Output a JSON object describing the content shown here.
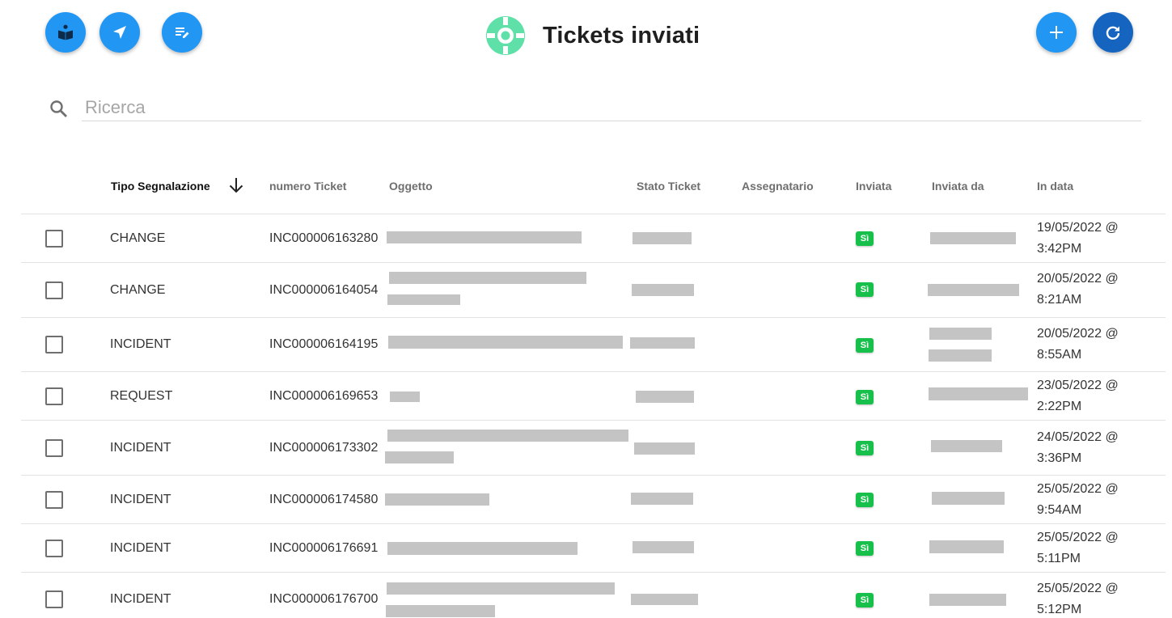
{
  "colors": {
    "fab_blue": "#2196f3",
    "fab_dark_blue": "#1565c0",
    "logo_green": "#5ee0a8",
    "badge_green": "#16c04b",
    "redaction_gray": "#c4c4c4"
  },
  "toolbar": {
    "left_buttons": [
      {
        "icon": "reading-book-icon"
      },
      {
        "icon": "send-navigation-icon"
      },
      {
        "icon": "edit-note-icon"
      }
    ],
    "right_buttons": [
      {
        "icon": "add-icon"
      },
      {
        "icon": "refresh-icon"
      }
    ]
  },
  "header": {
    "logo_icon": "lifebuoy-icon",
    "title": "Tickets inviati"
  },
  "search": {
    "icon": "search-icon",
    "placeholder": "Ricerca",
    "value": ""
  },
  "table": {
    "columns": [
      {
        "key": "tipo",
        "label": "Tipo Segnalazione",
        "sorted": true,
        "sort_direction": "descending"
      },
      {
        "key": "numero",
        "label": "numero Ticket"
      },
      {
        "key": "oggetto",
        "label": "Oggetto"
      },
      {
        "key": "stato",
        "label": "Stato Ticket"
      },
      {
        "key": "assegnatario",
        "label": "Assegnatario"
      },
      {
        "key": "inviata",
        "label": "Inviata"
      },
      {
        "key": "inviata_da",
        "label": "Inviata da"
      },
      {
        "key": "in_data",
        "label": "In data"
      }
    ],
    "rows": [
      {
        "tipo": "CHANGE",
        "numero": "INC000006163280",
        "inviata": "Sì",
        "date_line1": "19/05/2022 @",
        "date_line2": "3:42PM"
      },
      {
        "tipo": "CHANGE",
        "numero": "INC000006164054",
        "inviata": "Sì",
        "date_line1": "20/05/2022 @",
        "date_line2": "8:21AM"
      },
      {
        "tipo": "INCIDENT",
        "numero": "INC000006164195",
        "inviata": "Sì",
        "date_line1": "20/05/2022 @",
        "date_line2": "8:55AM"
      },
      {
        "tipo": "REQUEST",
        "numero": "INC000006169653",
        "inviata": "Sì",
        "date_line1": "23/05/2022 @",
        "date_line2": "2:22PM"
      },
      {
        "tipo": "INCIDENT",
        "numero": "INC000006173302",
        "inviata": "Sì",
        "date_line1": "24/05/2022 @",
        "date_line2": "3:36PM"
      },
      {
        "tipo": "INCIDENT",
        "numero": "INC000006174580",
        "inviata": "Sì",
        "date_line1": "25/05/2022 @",
        "date_line2": "9:54AM"
      },
      {
        "tipo": "INCIDENT",
        "numero": "INC000006176691",
        "inviata": "Sì",
        "date_line1": "25/05/2022 @",
        "date_line2": "5:11PM"
      },
      {
        "tipo": "INCIDENT",
        "numero": "INC000006176700",
        "inviata": "Sì",
        "date_line1": "25/05/2022 @",
        "date_line2": "5:12PM"
      }
    ]
  }
}
